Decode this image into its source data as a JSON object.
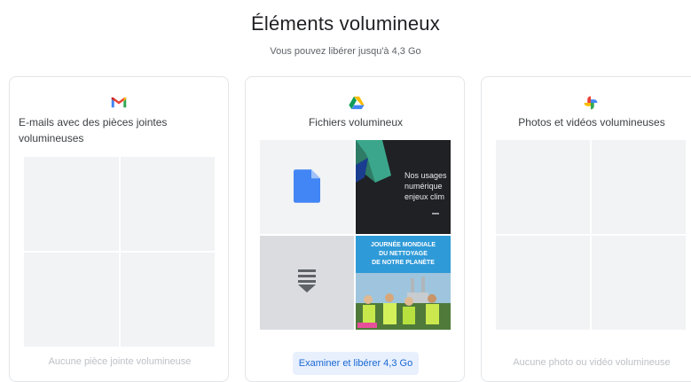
{
  "header": {
    "title": "Éléments volumineux",
    "subtitle": "Vous pouvez libérer jusqu'à 4,3 Go"
  },
  "cards": [
    {
      "icon": "gmail-icon",
      "label": "E-mails avec des pièces jointes volumineuses",
      "empty_text": "Aucune pièce jointe volumineuse"
    },
    {
      "icon": "google-drive-icon",
      "label": "Fichiers volumineux",
      "thumbnails": [
        {
          "kind": "doc-icon"
        },
        {
          "kind": "slide",
          "text": "Nos usages numérique enjeux clim"
        },
        {
          "kind": "download-icon"
        },
        {
          "kind": "poster",
          "text_lines": [
            "JOURNÉE MONDIALE",
            "DU NETTOYAGE",
            "DE NOTRE PLANÈTE"
          ]
        }
      ],
      "cta_label": "Examiner et libérer 4,3 Go"
    },
    {
      "icon": "google-photos-icon",
      "label": "Photos et vidéos volumineuses",
      "empty_text": "Aucune photo ou vidéo volumineuse"
    }
  ],
  "colors": {
    "accent": "#1967d2",
    "accent_bg": "#e8f0fe",
    "placeholder": "#f1f3f4",
    "slide_bg": "#202124",
    "poster_bg": "#2f9ad8"
  }
}
